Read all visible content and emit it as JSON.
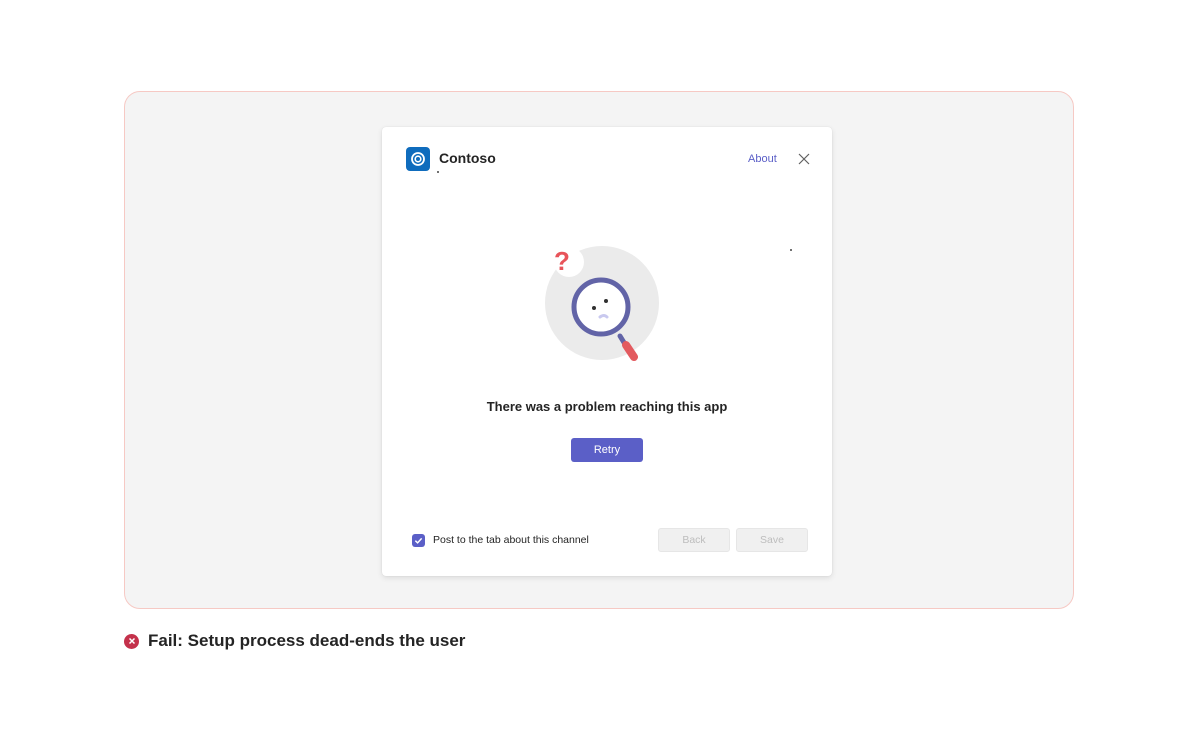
{
  "dialog": {
    "app_name": "Contoso",
    "about_label": "About",
    "message": "There was a problem reaching this app",
    "retry_label": "Retry",
    "checkbox_label": "Post to the tab about this channel",
    "checkbox_checked": true,
    "back_label": "Back",
    "save_label": "Save",
    "icons": {
      "app": "app-logo-icon",
      "close": "close-icon",
      "illustration": "magnifying-glass-confused-face-illustration",
      "checkbox": "checkmark-icon"
    }
  },
  "caption": {
    "icon": "fail-x-icon",
    "text": "Fail: Setup process dead-ends the user"
  },
  "colors": {
    "accent": "#5b5fc7",
    "app_blue": "#0f6cbd",
    "fail_red": "#c4314b",
    "frame_border": "#f6c9c4"
  }
}
